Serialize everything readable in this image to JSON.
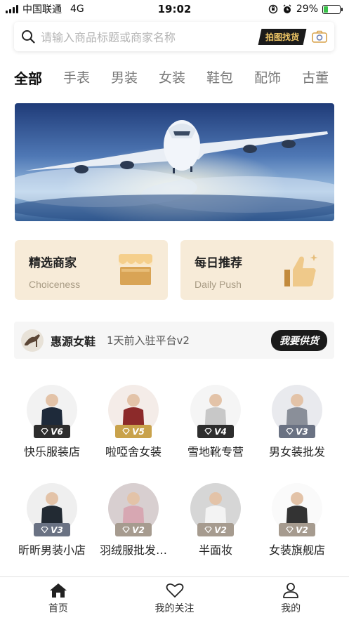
{
  "status_bar": {
    "carrier": "中国联通",
    "network": "4G",
    "time": "19:02",
    "battery": "29%",
    "battery_level": 0.29
  },
  "search": {
    "placeholder": "请输入商品标题或商家名称",
    "image_search_label": "拍图找货"
  },
  "tabs": [
    {
      "label": "全部",
      "active": true
    },
    {
      "label": "手表"
    },
    {
      "label": "男装"
    },
    {
      "label": "女装"
    },
    {
      "label": "鞋包"
    },
    {
      "label": "配饰"
    },
    {
      "label": "古董"
    }
  ],
  "features": [
    {
      "title": "精选商家",
      "subtitle": "Choiceness",
      "icon": "shop-awning-icon"
    },
    {
      "title": "每日推荐",
      "subtitle": "Daily Push",
      "icon": "thumbs-up-icon"
    }
  ],
  "merchant_strip": {
    "name": "惠源女鞋",
    "meta": "1天前入驻平台v2",
    "button": "我要供货"
  },
  "shops": [
    {
      "name": "快乐服装店",
      "level": "V6"
    },
    {
      "name": "啦啞舍女装",
      "level": "V5"
    },
    {
      "name": "雪地靴专营",
      "level": "V4"
    },
    {
      "name": "男女装批发",
      "level": "V3"
    },
    {
      "name": "昕昕男装小店",
      "level": "V3"
    },
    {
      "name": "羽绒服批发…",
      "level": "V2"
    },
    {
      "name": "半面妆",
      "level": "V2"
    },
    {
      "name": "女装旗舰店",
      "level": "V2"
    }
  ],
  "level_colors": {
    "V6": "#2d2d2d",
    "V5": "#c9a24b",
    "V4": "#2d2d2d",
    "V3": "#6a7283",
    "V2": "#a69b8f"
  },
  "bottom_nav": [
    {
      "label": "首页",
      "active": true
    },
    {
      "label": "我的关注"
    },
    {
      "label": "我的"
    }
  ]
}
